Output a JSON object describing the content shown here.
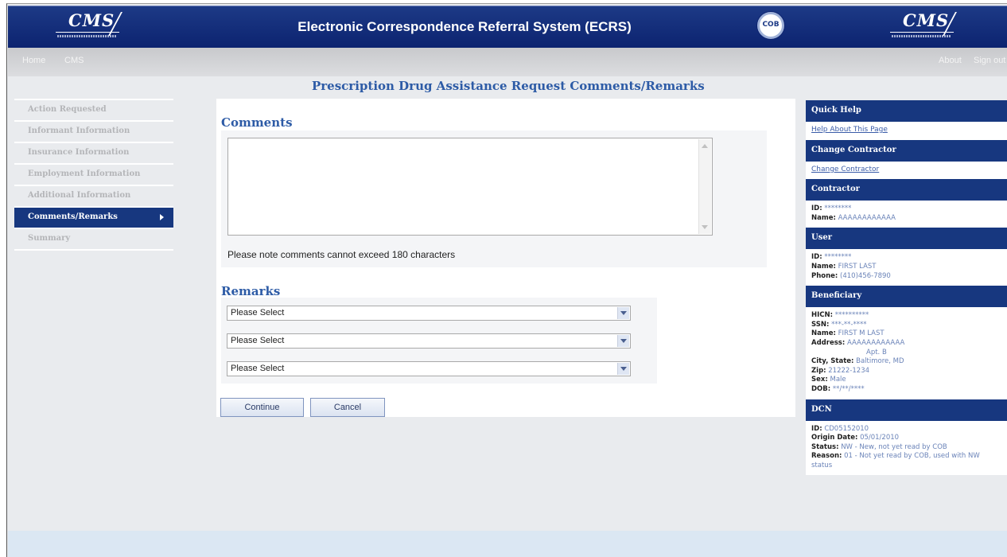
{
  "header": {
    "logo_left": "CMS",
    "title": "Electronic Correspondence Referral System (ECRS)",
    "seal_text": "COB",
    "logo_right": "CMS"
  },
  "nav": {
    "home": "Home",
    "cms": "CMS",
    "about": "About",
    "sign_out": "Sign out"
  },
  "page_title": "Prescription Drug Assistance Request Comments/Remarks",
  "leftnav": {
    "items": [
      {
        "label": "Action Requested"
      },
      {
        "label": "Informant Information"
      },
      {
        "label": "Insurance Information"
      },
      {
        "label": "Employment Information"
      },
      {
        "label": "Additional Information"
      },
      {
        "label": "Comments/Remarks",
        "active": true
      },
      {
        "label": "Summary"
      }
    ]
  },
  "comments": {
    "heading": "Comments",
    "value": "",
    "note": "Please note comments cannot exceed 180 characters"
  },
  "remarks": {
    "heading": "Remarks",
    "selects": [
      {
        "value": "Please Select"
      },
      {
        "value": "Please Select"
      },
      {
        "value": "Please Select"
      }
    ]
  },
  "buttons": {
    "continue": "Continue",
    "cancel": "Cancel"
  },
  "sidebar": {
    "quick_help": {
      "heading": "Quick Help",
      "link": "Help About This Page"
    },
    "change_contractor": {
      "heading": "Change Contractor",
      "link": "Change Contractor"
    },
    "contractor": {
      "heading": "Contractor",
      "id_label": "ID:",
      "id": "********",
      "name_label": "Name:",
      "name": "AAAAAAAAAAAA"
    },
    "user": {
      "heading": "User",
      "id_label": "ID:",
      "id": "********",
      "name_label": "Name:",
      "name": "FIRST LAST",
      "phone_label": "Phone:",
      "phone": "(410)456-7890"
    },
    "beneficiary": {
      "heading": "Beneficiary",
      "hicn_label": "HICN:",
      "hicn": "**********",
      "ssn_label": "SSN:",
      "ssn": "***-**-****",
      "name_label": "Name:",
      "name": "FIRST M LAST",
      "address_label": "Address:",
      "address1": "AAAAAAAAAAAA",
      "address2": "Apt. B",
      "city_label": "City, State:",
      "city": "Baltimore, MD",
      "zip_label": "Zip:",
      "zip": "21222-1234",
      "sex_label": "Sex:",
      "sex": "Male",
      "dob_label": "DOB:",
      "dob": "**/**/****"
    },
    "dcn": {
      "heading": "DCN",
      "id_label": "ID:",
      "id": "CD05152010",
      "origin_label": "Origin Date:",
      "origin": "05/01/2010",
      "status_label": "Status:",
      "status": "NW - New, not yet read by COB",
      "reason_label": "Reason:",
      "reason": "01 - Not yet read by COB, used with NW status"
    }
  }
}
